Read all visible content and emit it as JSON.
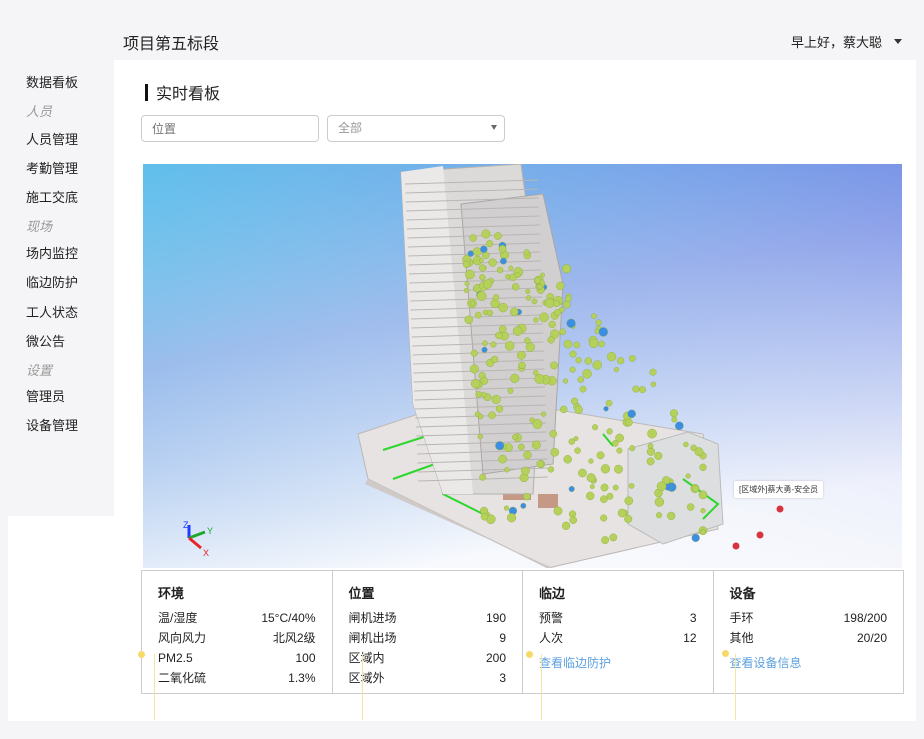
{
  "header": {
    "project_title": "项目第五标段",
    "greeting": "早上好，蔡大聪"
  },
  "sidebar": {
    "items": [
      {
        "label": "数据看板",
        "kind": "item"
      },
      {
        "label": "人员",
        "kind": "group"
      },
      {
        "label": "人员管理",
        "kind": "item"
      },
      {
        "label": "考勤管理",
        "kind": "item"
      },
      {
        "label": "施工交底",
        "kind": "item"
      },
      {
        "label": "现场",
        "kind": "group"
      },
      {
        "label": "场内监控",
        "kind": "item"
      },
      {
        "label": "临边防护",
        "kind": "item"
      },
      {
        "label": "工人状态",
        "kind": "item"
      },
      {
        "label": "微公告",
        "kind": "item"
      },
      {
        "label": "设置",
        "kind": "group"
      },
      {
        "label": "管理员",
        "kind": "item"
      },
      {
        "label": "设备管理",
        "kind": "item"
      }
    ]
  },
  "main": {
    "section_title": "实时看板",
    "filters": {
      "position_placeholder": "位置",
      "select_value": "全部"
    },
    "viewer": {
      "tooltip": "[区域外]蔡大勇-安全员",
      "axes": {
        "x": "X",
        "y": "Y",
        "z": "Z"
      }
    },
    "cards": [
      {
        "title": "环境",
        "rows": [
          {
            "label": "温/湿度",
            "value": "15°C/40%"
          },
          {
            "label": "风向风力",
            "value": "北风2级"
          },
          {
            "label": "PM2.5",
            "value": "100"
          },
          {
            "label": "二氧化硫",
            "value": "1.3%"
          }
        ]
      },
      {
        "title": "位置",
        "rows": [
          {
            "label": "闸机进场",
            "value": "190"
          },
          {
            "label": "闸机出场",
            "value": "9"
          },
          {
            "label": "区域内",
            "value": "200"
          },
          {
            "label": "区域外",
            "value": "3"
          }
        ]
      },
      {
        "title": "临边",
        "rows": [
          {
            "label": "预警",
            "value": "3"
          },
          {
            "label": "人次",
            "value": "12"
          }
        ],
        "link": "查看临边防护"
      },
      {
        "title": "设备",
        "rows": [
          {
            "label": "手环",
            "value": "198/200"
          },
          {
            "label": "其他",
            "value": "20/20"
          }
        ],
        "link": "查看设备信息"
      }
    ]
  },
  "colors": {
    "accent_link": "#5ea1e0",
    "marker_green": "#b5d15c",
    "marker_red": "#d9343e",
    "marker_blue": "#3a8ee6",
    "sky_top": "#2ec7e8",
    "sky_bottom": "#ffffff"
  }
}
